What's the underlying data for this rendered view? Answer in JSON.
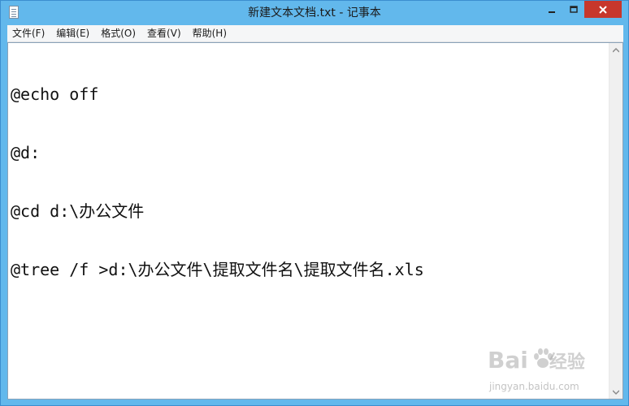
{
  "window": {
    "title": "新建文本文档.txt - 记事本",
    "icon": "notepad-icon"
  },
  "controls": {
    "minimize_icon": "minimize-icon",
    "maximize_icon": "maximize-icon",
    "close_icon": "close-icon",
    "close_color": "#c7372c"
  },
  "menubar": {
    "items": [
      {
        "label": "文件(F)"
      },
      {
        "label": "编辑(E)"
      },
      {
        "label": "格式(O)"
      },
      {
        "label": "查看(V)"
      },
      {
        "label": "帮助(H)"
      }
    ]
  },
  "editor": {
    "lines": [
      "@echo off",
      "@d:",
      "@cd d:\\办公文件",
      "@tree /f >d:\\办公文件\\提取文件名\\提取文件名.xls"
    ]
  },
  "watermark": {
    "brand": "Bai",
    "brand_suffix": "经验",
    "url": "jingyan.baidu.com"
  },
  "colors": {
    "titlebar": "#62b8ec",
    "menubar": "#f5f6f7",
    "editor_bg": "#ffffff"
  }
}
